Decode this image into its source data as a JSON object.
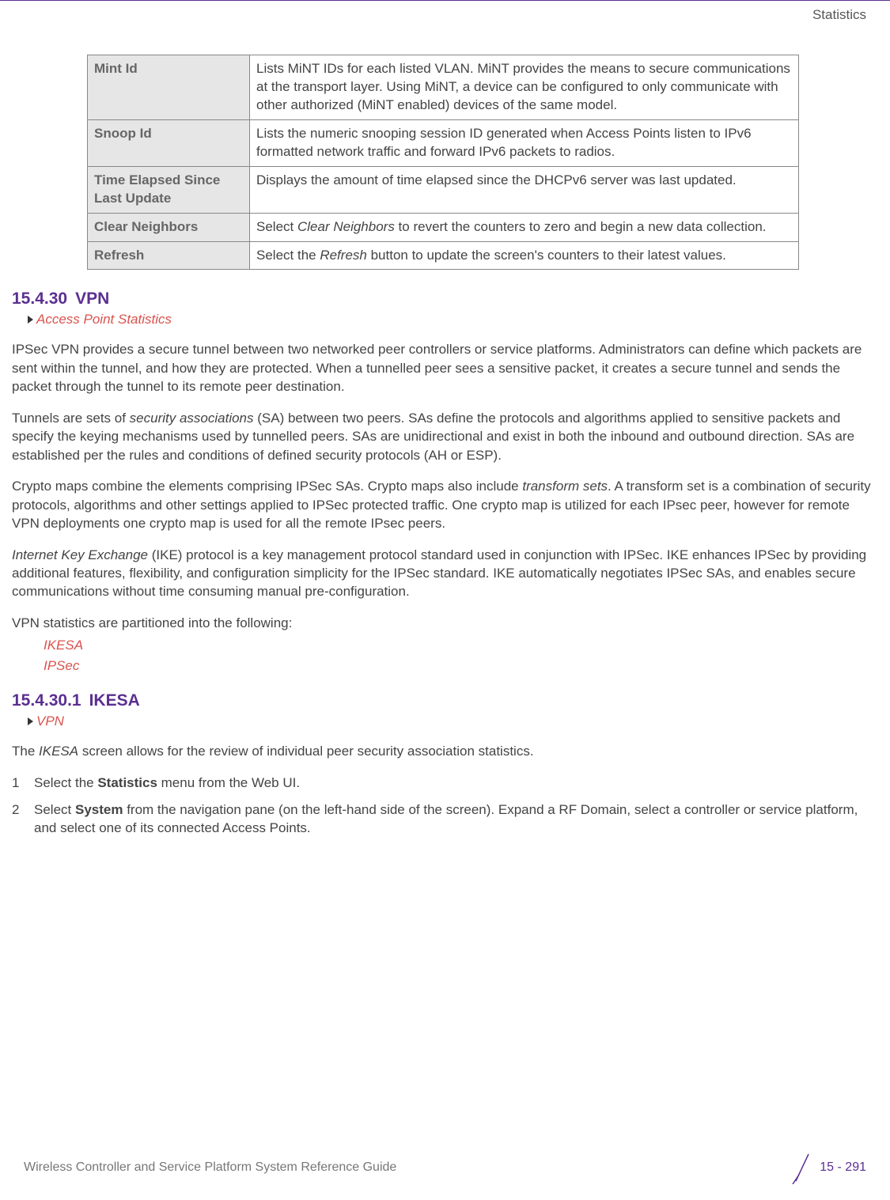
{
  "header": {
    "section": "Statistics"
  },
  "table": {
    "rows": [
      {
        "term": "Mint Id",
        "desc": "Lists MiNT IDs for each listed VLAN. MiNT provides the means to secure communications at the transport layer. Using MiNT, a device can be configured to only communicate with other authorized (MiNT enabled) devices of the same model."
      },
      {
        "term": "Snoop Id",
        "desc": "Lists the numeric snooping session ID generated when Access Points listen to IPv6 formatted network traffic and forward IPv6 packets to radios."
      },
      {
        "term": "Time Elapsed Since Last Update",
        "desc": "Displays the amount of time elapsed since the DHCPv6 server was last updated."
      },
      {
        "term": "Clear Neighbors",
        "desc_pre": "Select ",
        "desc_em": "Clear Neighbors",
        "desc_post": " to revert the counters to zero and begin a new data collection."
      },
      {
        "term": "Refresh",
        "desc_pre": "Select the ",
        "desc_em": "Refresh",
        "desc_post": " button to update the screen's counters to their latest values."
      }
    ]
  },
  "sec1": {
    "num": "15.4.30",
    "title": "VPN",
    "bc": "Access Point Statistics",
    "p1": "IPSec VPN provides a secure tunnel between two networked peer controllers or service platforms. Administrators can define which packets are sent within the tunnel, and how they are protected. When a tunnelled peer sees a sensitive packet, it creates a secure tunnel and sends the packet through the tunnel to its remote peer destination.",
    "p2_pre": "Tunnels are sets of ",
    "p2_em": "security associations",
    "p2_post": " (SA) between two peers. SAs define the protocols and algorithms applied to sensitive packets and specify the keying mechanisms used by tunnelled peers. SAs are unidirectional and exist in both the inbound and outbound direction. SAs are established per the rules and conditions of defined security protocols (AH or ESP).",
    "p3_pre": "Crypto maps combine the elements comprising IPSec SAs. Crypto maps also include ",
    "p3_em": "transform sets",
    "p3_post": ". A transform set is a combination of security protocols, algorithms and other settings applied to IPSec protected traffic. One crypto map is utilized for each IPsec peer, however for remote VPN deployments one crypto map is used for all the remote IPsec peers.",
    "p4_em": "Internet Key Exchange",
    "p4_post": " (IKE) protocol is a key management protocol standard used in conjunction with IPSec. IKE enhances IPSec by providing additional features, flexibility, and configuration simplicity for the IPSec standard. IKE automatically negotiates IPSec SAs, and enables secure communications without time consuming manual pre-configuration.",
    "p5": "VPN statistics are partitioned into the following:",
    "links": [
      "IKESA",
      "IPSec"
    ]
  },
  "sec2": {
    "num": "15.4.30.1",
    "title": "IKESA",
    "bc": "VPN",
    "intro_pre": " The ",
    "intro_em": "IKESA",
    "intro_post": " screen allows for the review of individual peer security association statistics.",
    "step1_pre": "Select the ",
    "step1_b": "Statistics",
    "step1_post": " menu from the Web UI.",
    "step2_pre": "Select ",
    "step2_b": "System",
    "step2_post": " from the navigation pane (on the left-hand side of the screen). Expand a RF Domain, select a controller or service platform, and select one of its connected Access Points."
  },
  "footer": {
    "left": "Wireless Controller and Service Platform System Reference Guide",
    "page": "15 - 291"
  }
}
